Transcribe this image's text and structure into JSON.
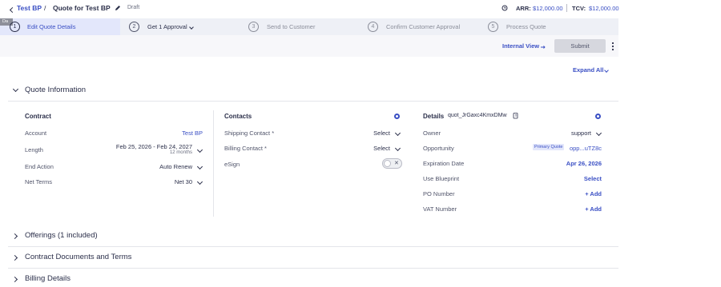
{
  "header": {
    "breadcrumb_parent": "Test BP",
    "breadcrumb_sep": "/",
    "quote_title": "Quote for Test BP",
    "status": "Draft",
    "arr_label": "ARR:",
    "arr_value": "$12,000.00",
    "tcv_label": "TCV:",
    "tcv_value": "$12,000.00"
  },
  "steps": [
    {
      "num": "1",
      "label": "Edit Quote Details"
    },
    {
      "num": "2",
      "label": "Get 1 Approval"
    },
    {
      "num": "3",
      "label": "Send to Customer"
    },
    {
      "num": "4",
      "label": "Confirm Customer Approval"
    },
    {
      "num": "5",
      "label": "Process Quote"
    }
  ],
  "tooltip_fragment": "Da",
  "toolbar": {
    "internal_view": "Internal View",
    "submit": "Submit"
  },
  "expand_all": "Expand All",
  "quote_information": {
    "title": "Quote Information",
    "contract": {
      "title": "Contract",
      "account_label": "Account",
      "account_value": "Test BP",
      "length_label": "Length",
      "length_value": "Feb 25, 2026 - Feb 24, 2027",
      "length_sub": "12 months",
      "end_action_label": "End Action",
      "end_action_value": "Auto Renew",
      "net_terms_label": "Net Terms",
      "net_terms_value": "Net 30"
    },
    "contacts": {
      "title": "Contacts",
      "shipping_label": "Shipping Contact *",
      "shipping_value": "Select",
      "billing_label": "Billing Contact *",
      "billing_value": "Select",
      "esign_label": "eSign"
    },
    "details": {
      "title": "Details",
      "quote_id": "quot_JrGaxc4KmxDMw",
      "owner_label": "Owner",
      "owner_value": "support",
      "opportunity_label": "Opportunity",
      "primary_badge": "Primary Quote",
      "opportunity_value": "opp...uTZ8c",
      "expiration_label": "Expiration Date",
      "expiration_value": "Apr 26, 2026",
      "blueprint_label": "Use Blueprint",
      "blueprint_value": "Select",
      "po_label": "PO Number",
      "po_value": "+ Add",
      "vat_label": "VAT Number",
      "vat_value": "+ Add"
    }
  },
  "sections": [
    {
      "title": "Offerings (1 included)"
    },
    {
      "title": "Contract Documents and Terms"
    },
    {
      "title": "Billing Details"
    }
  ],
  "colors": {
    "accent": "#3a4fc4",
    "stepper_bg": "#eef0f6",
    "active_step_bg": "#e3e7fb",
    "submit_bg": "#d6d7de"
  }
}
